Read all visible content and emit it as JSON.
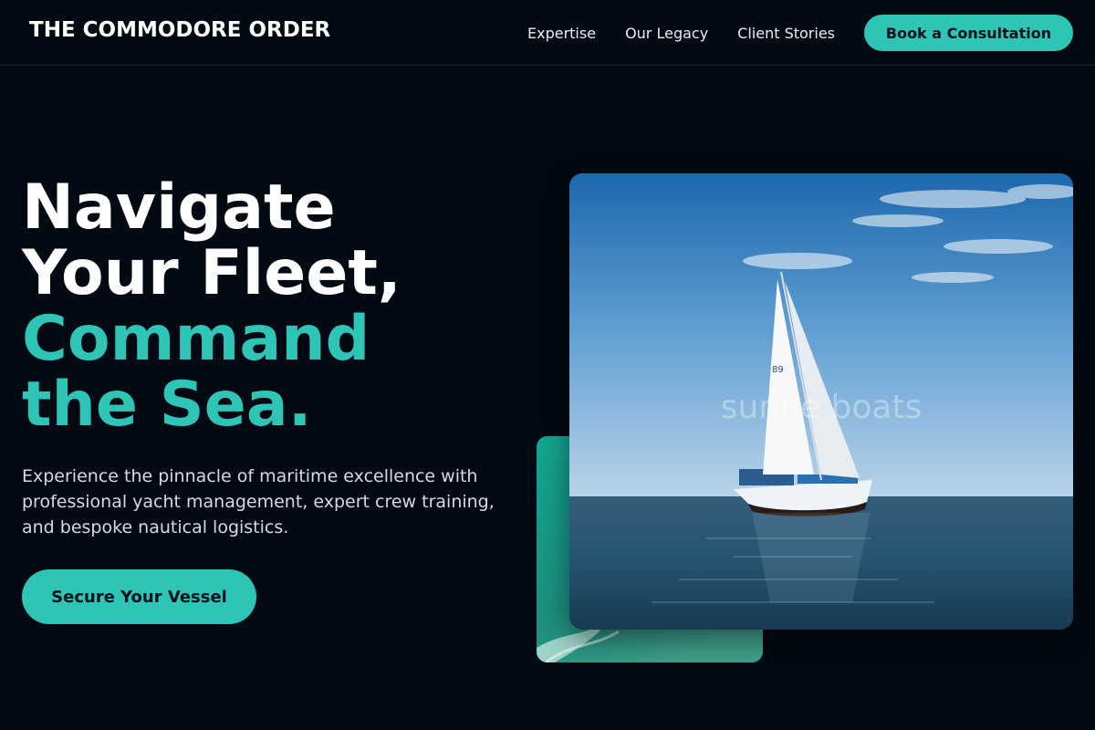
{
  "header": {
    "brand": "THE COMMODORE ORDER",
    "nav": [
      {
        "label": "Expertise"
      },
      {
        "label": "Our Legacy"
      },
      {
        "label": "Client Stories"
      }
    ],
    "cta_label": "Book a Consultation"
  },
  "hero": {
    "headline_lines": [
      "Navigate",
      "Your Fleet,"
    ],
    "headline_accent_lines": [
      "Command",
      "the Sea."
    ],
    "lead": "Experience the pinnacle of maritime excellence with professional yacht management, expert crew training, and bespoke nautical logistics.",
    "cta_label": "Secure Your Vessel"
  },
  "media": {
    "watermark": "sunne boats",
    "sail_markings": [
      "89"
    ]
  },
  "colors": {
    "accent": "#2ec4b6",
    "background": "#010a12",
    "text": "#ffffff",
    "muted_text": "#d3dbe2"
  },
  "icons": {
    "main_photo": "sailboat-photo",
    "accent_tile": "sea-water-photo"
  }
}
